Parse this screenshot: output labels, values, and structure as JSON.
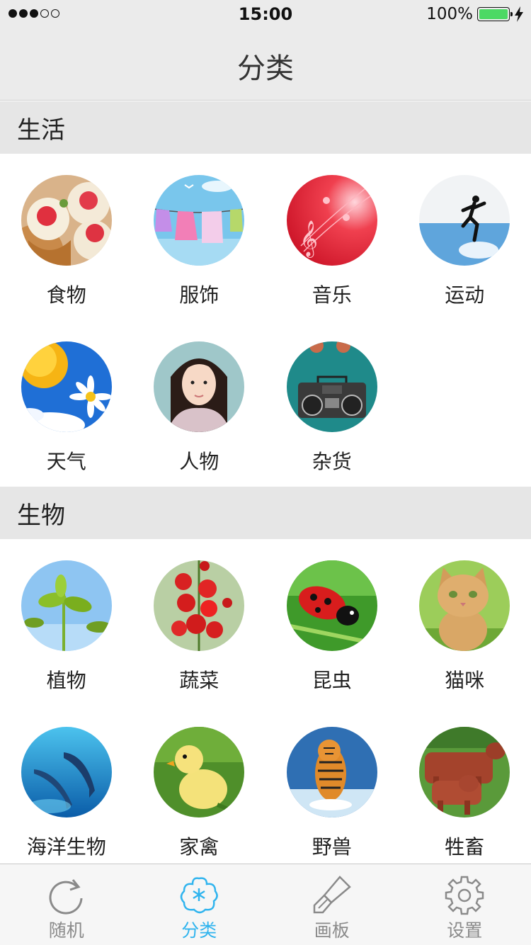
{
  "status_bar": {
    "time": "15:00",
    "battery_percent": "100%",
    "signal_bars_filled": 3,
    "signal_bars_total": 5
  },
  "nav": {
    "title": "分类"
  },
  "sections": [
    {
      "title": "生活",
      "items": [
        {
          "label": "食物",
          "icon": "cupcake-photo"
        },
        {
          "label": "服饰",
          "icon": "clothesline-photo"
        },
        {
          "label": "音乐",
          "icon": "music-notes-photo"
        },
        {
          "label": "运动",
          "icon": "runner-photo"
        },
        {
          "label": "天气",
          "icon": "sun-daisy-photo"
        },
        {
          "label": "人物",
          "icon": "girl-portrait-photo"
        },
        {
          "label": "杂货",
          "icon": "boombox-photo"
        }
      ]
    },
    {
      "title": "生物",
      "items": [
        {
          "label": "植物",
          "icon": "sprout-photo"
        },
        {
          "label": "蔬菜",
          "icon": "tomatoes-photo"
        },
        {
          "label": "昆虫",
          "icon": "ladybug-photo"
        },
        {
          "label": "猫咪",
          "icon": "kitten-photo"
        },
        {
          "label": "海洋生物",
          "icon": "dolphins-photo"
        },
        {
          "label": "家禽",
          "icon": "duckling-photo"
        },
        {
          "label": "野兽",
          "icon": "tiger-photo"
        },
        {
          "label": "牲畜",
          "icon": "cattle-photo"
        }
      ]
    }
  ],
  "tabs": [
    {
      "label": "随机",
      "icon": "refresh-icon",
      "active": false
    },
    {
      "label": "分类",
      "icon": "flower-icon",
      "active": true
    },
    {
      "label": "画板",
      "icon": "brush-icon",
      "active": false
    },
    {
      "label": "设置",
      "icon": "gear-icon",
      "active": false
    }
  ],
  "colors": {
    "accent": "#30b4ee",
    "inactive": "#8a8a8a",
    "bar_bg": "#ebebeb",
    "battery": "#4cd964"
  }
}
